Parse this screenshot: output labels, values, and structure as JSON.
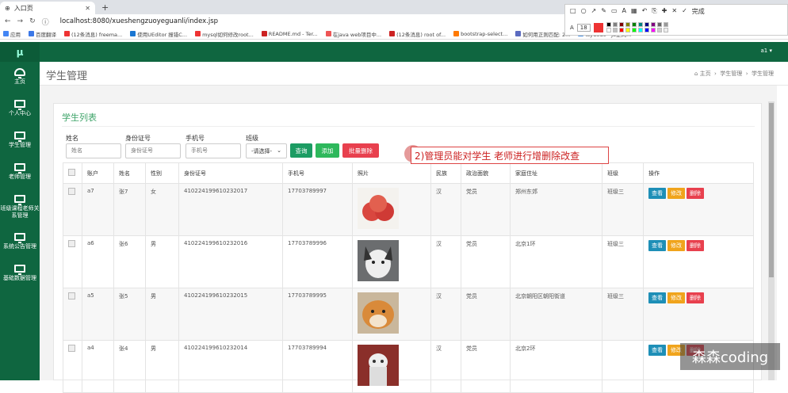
{
  "browser": {
    "tab_title": "入口页",
    "url": "localhost:8080/xueshengzuoyeguanli/index.jsp",
    "bookmarks": [
      "应用",
      "百度翻译",
      "(12条消息) freema...",
      "使用UEditor 报错C...",
      "mysql如何修改root...",
      "README.md - Ter...",
      "在java web项目中...",
      "(12条消息) root of...",
      "bootstrap-select...",
      "如何用正则匹配: 2...",
      "layCode - JS逆向..."
    ]
  },
  "annotation_toolbar": {
    "font_label": "A",
    "font_size": "18",
    "finish_label": "完成"
  },
  "sidebar": {
    "logo": "μ",
    "items": [
      {
        "label": "主页",
        "icon": "dashboard-icon"
      },
      {
        "label": "个人中心",
        "icon": "monitor-icon"
      },
      {
        "label": "学生管理",
        "icon": "monitor-icon"
      },
      {
        "label": "老师管理",
        "icon": "monitor-icon"
      },
      {
        "label": "班级课程老师关系管理",
        "icon": "monitor-icon"
      },
      {
        "label": "系统公告管理",
        "icon": "monitor-icon"
      },
      {
        "label": "基础数据管理",
        "icon": "monitor-icon"
      }
    ]
  },
  "topbar": {
    "user": "a1 ▾"
  },
  "page": {
    "title": "学生管理",
    "breadcrumb": [
      "主页",
      "学生管理",
      "学生管理"
    ]
  },
  "panel": {
    "title": "学生列表",
    "filters": {
      "name": {
        "label": "姓名",
        "placeholder": "姓名"
      },
      "idcard": {
        "label": "身份证号",
        "placeholder": "身份证号"
      },
      "phone": {
        "label": "手机号",
        "placeholder": "手机号"
      },
      "class": {
        "label": "班级",
        "value": "-请选择-"
      }
    },
    "buttons": {
      "search": "查询",
      "add": "添加",
      "batch_delete": "批量删除"
    }
  },
  "note": "2)管理员能对学生 老师进行增删除改查",
  "table": {
    "headers": [
      "账户",
      "姓名",
      "性别",
      "身份证号",
      "手机号",
      "照片",
      "民族",
      "政治面貌",
      "家庭住址",
      "班级",
      "操作"
    ],
    "rows": [
      [
        "a7",
        "张7",
        "女",
        "410224199610232017",
        "17703789997",
        "apple",
        "汉",
        "党员",
        "郑州东郊",
        "班级三"
      ],
      [
        "a6",
        "张6",
        "男",
        "410224199610232016",
        "17703789996",
        "husky",
        "汉",
        "党员",
        "北京1环",
        "班级三"
      ],
      [
        "a5",
        "张5",
        "男",
        "410224199610232015",
        "17703789995",
        "shiba",
        "汉",
        "党员",
        "北京朝阳区朝阳街道",
        "班级三"
      ],
      [
        "a4",
        "张4",
        "男",
        "410224199610232014",
        "17703789994",
        "cat",
        "汉",
        "党员",
        "北京2环",
        ""
      ]
    ],
    "ops": {
      "view": "查看",
      "edit": "修改",
      "delete": "删除"
    }
  },
  "colors": {
    "sidebar": "#0f6640",
    "accent": "#3fa46a",
    "view": "#1e8fb7",
    "edit": "#f0a41c",
    "delete": "#e8404e"
  },
  "watermark": "森森coding"
}
